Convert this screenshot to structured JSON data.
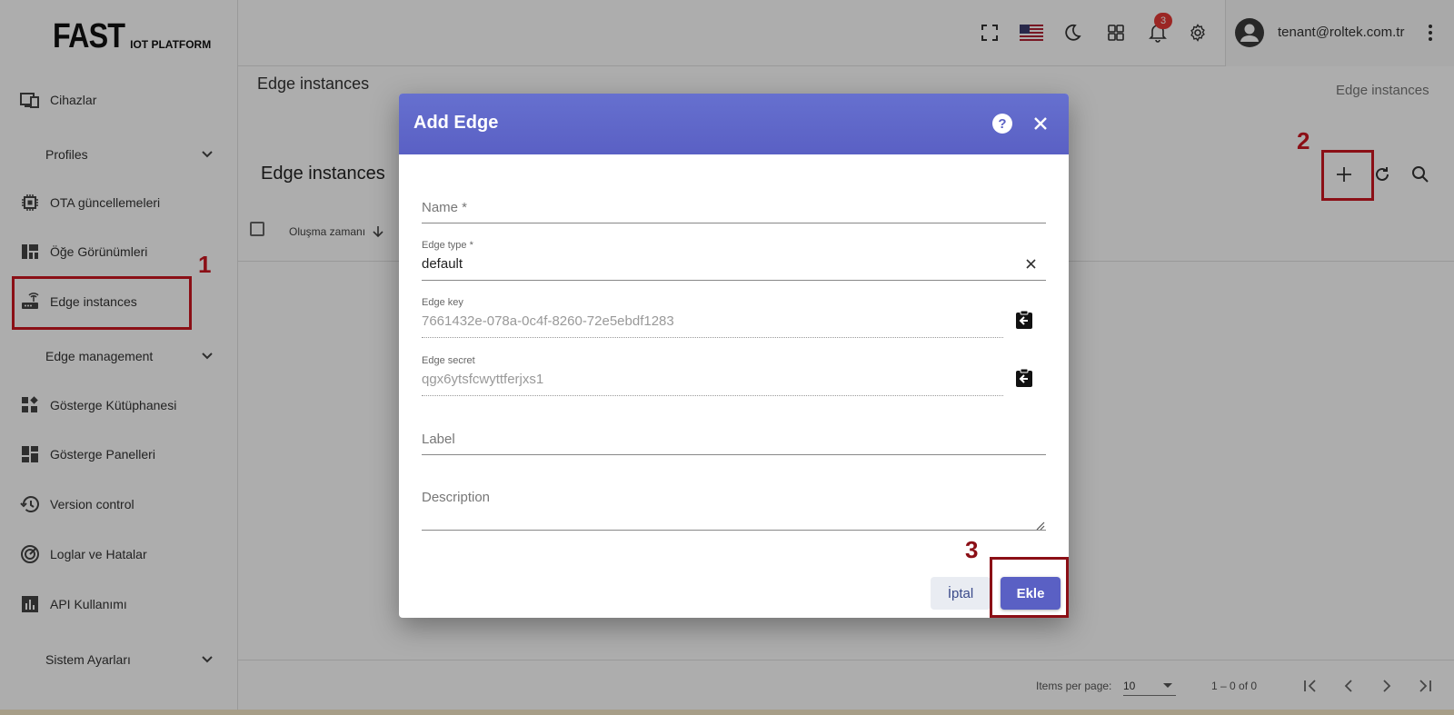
{
  "brand": {
    "logo_big": "FAST",
    "logo_small": "IOT PLATFORM"
  },
  "sidebar": {
    "items": [
      {
        "label": "Cihazlar",
        "icon": "devices-icon"
      },
      {
        "label": "Profiles",
        "icon": "chevron-down-icon"
      },
      {
        "label": "OTA güncellemeleri",
        "icon": "chip-icon"
      },
      {
        "label": "Öğe Görünümleri",
        "icon": "view-quilt-icon"
      },
      {
        "label": "Edge instances",
        "icon": "router-icon"
      },
      {
        "label": "Edge management",
        "icon": "chevron-down-icon"
      },
      {
        "label": "Gösterge Kütüphanesi",
        "icon": "widgets-icon"
      },
      {
        "label": "Gösterge Panelleri",
        "icon": "dashboard-icon"
      },
      {
        "label": "Version control",
        "icon": "history-icon"
      },
      {
        "label": "Loglar ve Hatalar",
        "icon": "track-changes-icon"
      },
      {
        "label": "API Kullanımı",
        "icon": "bar-chart-icon"
      },
      {
        "label": "Sistem Ayarları",
        "icon": "chevron-down-icon"
      }
    ]
  },
  "topbar": {
    "notifications_count": "3",
    "user_email": "tenant@roltek.com.tr"
  },
  "main": {
    "page_title": "Edge instances",
    "breadcrumb": "Edge instances",
    "card_title": "Edge instances",
    "column_created": "Oluşma zamanı",
    "items_per_page_label": "Items per page:",
    "items_per_page_value": "10",
    "range_label": "1 – 0 of 0"
  },
  "dialog": {
    "title": "Add Edge",
    "name_placeholder": "Name *",
    "edge_type_label": "Edge type *",
    "edge_type_value": "default",
    "edge_key_label": "Edge key",
    "edge_key_value": "7661432e-078a-0c4f-8260-72e5ebdf1283",
    "edge_secret_label": "Edge secret",
    "edge_secret_value": "qgx6ytsfcwyttferjxs1",
    "label_placeholder": "Label",
    "description_placeholder": "Description",
    "cancel_label": "İptal",
    "add_label": "Ekle"
  },
  "annotations": {
    "step1": "1",
    "step2": "2",
    "step3": "3"
  },
  "colors": {
    "accent": "#5a60c4",
    "annotation": "#8b0f16",
    "badge": "#e53935"
  }
}
